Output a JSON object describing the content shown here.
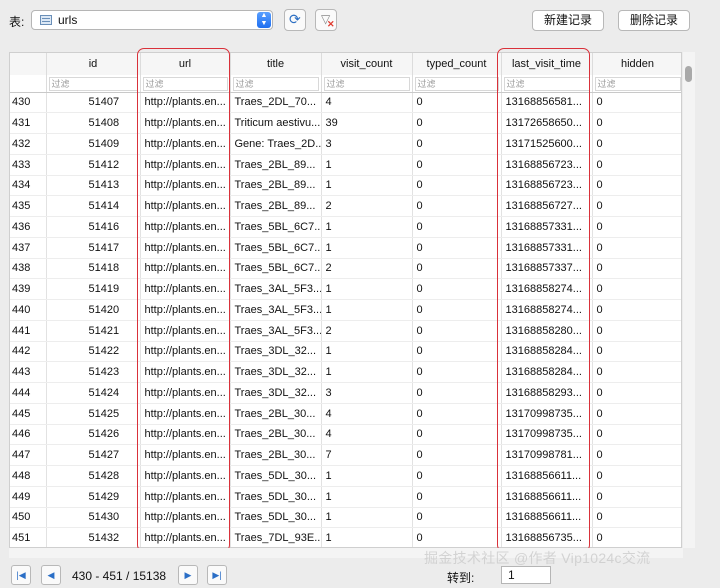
{
  "toolbar": {
    "table_label": "表:",
    "table_name": "urls",
    "new_record": "新建记录",
    "delete_record": "删除记录"
  },
  "grid": {
    "columns": [
      "id",
      "url",
      "title",
      "visit_count",
      "typed_count",
      "last_visit_time",
      "hidden"
    ],
    "filter_placeholder": "过滤",
    "rows": [
      [
        "430",
        "51407",
        "http://plants.en...",
        "Traes_2DL_70...",
        "4",
        "0",
        "13168856581...",
        "0"
      ],
      [
        "431",
        "51408",
        "http://plants.en...",
        "Triticum aestivu...",
        "39",
        "0",
        "13172658650...",
        "0"
      ],
      [
        "432",
        "51409",
        "http://plants.en...",
        "Gene: Traes_2D...",
        "3",
        "0",
        "13171525600...",
        "0"
      ],
      [
        "433",
        "51412",
        "http://plants.en...",
        "Traes_2BL_89...",
        "1",
        "0",
        "13168856723...",
        "0"
      ],
      [
        "434",
        "51413",
        "http://plants.en...",
        "Traes_2BL_89...",
        "1",
        "0",
        "13168856723...",
        "0"
      ],
      [
        "435",
        "51414",
        "http://plants.en...",
        "Traes_2BL_89...",
        "2",
        "0",
        "13168856727...",
        "0"
      ],
      [
        "436",
        "51416",
        "http://plants.en...",
        "Traes_5BL_6C7...",
        "1",
        "0",
        "13168857331...",
        "0"
      ],
      [
        "437",
        "51417",
        "http://plants.en...",
        "Traes_5BL_6C7...",
        "1",
        "0",
        "13168857331...",
        "0"
      ],
      [
        "438",
        "51418",
        "http://plants.en...",
        "Traes_5BL_6C7...",
        "2",
        "0",
        "13168857337...",
        "0"
      ],
      [
        "439",
        "51419",
        "http://plants.en...",
        "Traes_3AL_5F3...",
        "1",
        "0",
        "13168858274...",
        "0"
      ],
      [
        "440",
        "51420",
        "http://plants.en...",
        "Traes_3AL_5F3...",
        "1",
        "0",
        "13168858274...",
        "0"
      ],
      [
        "441",
        "51421",
        "http://plants.en...",
        "Traes_3AL_5F3...",
        "2",
        "0",
        "13168858280...",
        "0"
      ],
      [
        "442",
        "51422",
        "http://plants.en...",
        "Traes_3DL_32...",
        "1",
        "0",
        "13168858284...",
        "0"
      ],
      [
        "443",
        "51423",
        "http://plants.en...",
        "Traes_3DL_32...",
        "1",
        "0",
        "13168858284...",
        "0"
      ],
      [
        "444",
        "51424",
        "http://plants.en...",
        "Traes_3DL_32...",
        "3",
        "0",
        "13168858293...",
        "0"
      ],
      [
        "445",
        "51425",
        "http://plants.en...",
        "Traes_2BL_30...",
        "4",
        "0",
        "13170998735...",
        "0"
      ],
      [
        "446",
        "51426",
        "http://plants.en...",
        "Traes_2BL_30...",
        "4",
        "0",
        "13170998735...",
        "0"
      ],
      [
        "447",
        "51427",
        "http://plants.en...",
        "Traes_2BL_30...",
        "7",
        "0",
        "13170998781...",
        "0"
      ],
      [
        "448",
        "51428",
        "http://plants.en...",
        "Traes_5DL_30...",
        "1",
        "0",
        "13168856611...",
        "0"
      ],
      [
        "449",
        "51429",
        "http://plants.en...",
        "Traes_5DL_30...",
        "1",
        "0",
        "13168856611...",
        "0"
      ],
      [
        "450",
        "51430",
        "http://plants.en...",
        "Traes_5DL_30...",
        "1",
        "0",
        "13168856611...",
        "0"
      ],
      [
        "451",
        "51432",
        "http://plants.en...",
        "Traes_7DL_93E...",
        "1",
        "0",
        "13168856735...",
        "0"
      ]
    ]
  },
  "pagination": {
    "range_text": "430 - 451 / 15138",
    "goto_label": "转到:",
    "goto_value": "1"
  },
  "watermark": "掘金技术社区 @作者 Vip1024c交流",
  "colors": {
    "highlight": "#d9313a",
    "accent": "#1e6ef0"
  }
}
